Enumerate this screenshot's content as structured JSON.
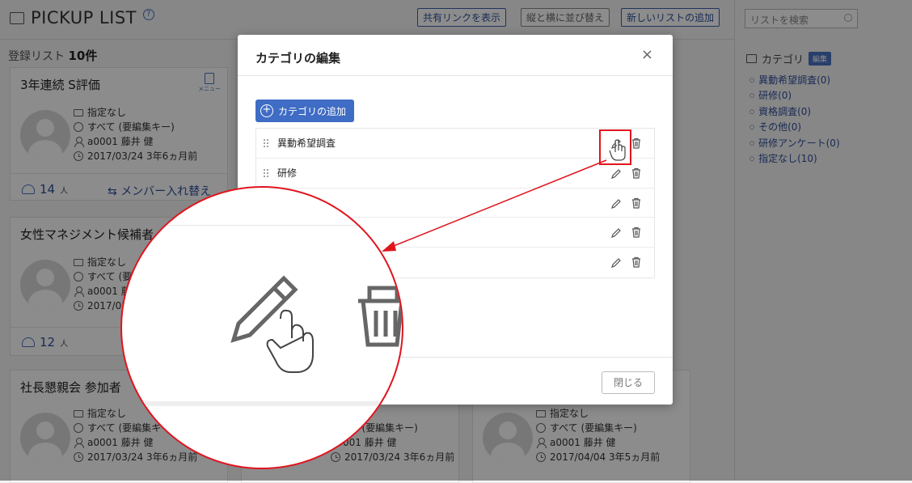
{
  "header": {
    "title": "PICKUP LIST",
    "share_link_btn": "共有リンクを表示",
    "sort_btn": "縦と横に並び替え",
    "add_list_btn": "新しいリストの追加"
  },
  "registered": {
    "label": "登録リスト",
    "count": "10件"
  },
  "cards": [
    {
      "title": "3年連続 S評価",
      "menu": "メニュー",
      "category": "指定なし",
      "scope": "すべて (要編集キー)",
      "owner": "a0001 藤井 健",
      "date": "2017/03/24 3年6ヵ月前",
      "members": "14",
      "members_unit": "人",
      "swap": "メンバー入れ替え"
    },
    {
      "title": "女性マネジメント候補者",
      "category": "指定なし",
      "scope": "すべて (要編集キー)",
      "owner": "a0001 藤井 健",
      "date": "2017/03/24 3年6ヵ月前",
      "members": "12",
      "members_unit": "人"
    },
    {
      "title": "社長懇親会 参加者",
      "category": "指定なし",
      "scope": "すべて (要編集キー)",
      "owner": "a0001 藤井 健",
      "date": "2017/03/24 3年6ヵ月前"
    },
    {
      "scope": "すべて (要編集キー)",
      "owner": "a0001 藤井 健",
      "date": "2017/03/24 3年6ヵ月前"
    },
    {
      "category": "指定なし",
      "scope": "すべて (要編集キー)",
      "owner": "a0001 藤井 健",
      "date": "2017/04/04 3年5ヵ月前"
    }
  ],
  "sidebar": {
    "search_placeholder": "リストを検索",
    "category_label": "カテゴリ",
    "edit_label": "編集",
    "categories": [
      "異動希望調査(0)",
      "研修(0)",
      "資格調査(0)",
      "その他(0)",
      "研修アンケート(0)",
      "指定なし(10)"
    ]
  },
  "modal": {
    "title": "カテゴリの編集",
    "close_icon": "×",
    "add_btn": "カテゴリの追加",
    "rows": [
      "異動希望調査",
      "研修",
      "",
      "",
      ""
    ],
    "close_btn": "閉じる"
  },
  "colors": {
    "accent": "#3f6cc4",
    "highlight": "#e0141e"
  }
}
